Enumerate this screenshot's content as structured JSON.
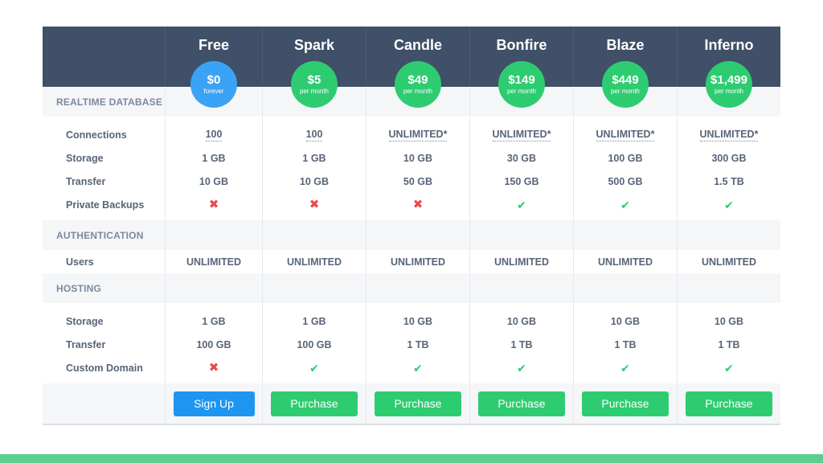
{
  "plans": [
    {
      "name": "Free",
      "price": "$0",
      "period": "forever",
      "accent": "#3aa3f5",
      "button": "Sign Up"
    },
    {
      "name": "Spark",
      "price": "$5",
      "period": "per month",
      "accent": "#2ecc71",
      "button": "Purchase"
    },
    {
      "name": "Candle",
      "price": "$49",
      "period": "per month",
      "accent": "#2ecc71",
      "button": "Purchase"
    },
    {
      "name": "Bonfire",
      "price": "$149",
      "period": "per month",
      "accent": "#2ecc71",
      "button": "Purchase"
    },
    {
      "name": "Blaze",
      "price": "$449",
      "period": "per month",
      "accent": "#2ecc71",
      "button": "Purchase"
    },
    {
      "name": "Inferno",
      "price": "$1,499",
      "period": "per month",
      "accent": "#2ecc71",
      "button": "Purchase"
    }
  ],
  "sections": [
    {
      "title": "REALTIME DATABASE",
      "rows": [
        {
          "label": "Connections",
          "values": [
            "100",
            "100",
            "UNLIMITED*",
            "UNLIMITED*",
            "UNLIMITED*",
            "UNLIMITED*"
          ]
        },
        {
          "label": "Storage",
          "values": [
            "1 GB",
            "1 GB",
            "10 GB",
            "30 GB",
            "100 GB",
            "300 GB"
          ]
        },
        {
          "label": "Transfer",
          "values": [
            "10 GB",
            "10 GB",
            "50 GB",
            "150 GB",
            "500 GB",
            "1.5 TB"
          ]
        },
        {
          "label": "Private Backups",
          "values": [
            "x",
            "x",
            "x",
            "check",
            "check",
            "check"
          ]
        }
      ]
    },
    {
      "title": "AUTHENTICATION",
      "rows": [
        {
          "label": "Users",
          "values": [
            "UNLIMITED",
            "UNLIMITED",
            "UNLIMITED",
            "UNLIMITED",
            "UNLIMITED",
            "UNLIMITED"
          ]
        }
      ]
    },
    {
      "title": "HOSTING",
      "rows": [
        {
          "label": "Storage",
          "values": [
            "1 GB",
            "1 GB",
            "10 GB",
            "10 GB",
            "10 GB",
            "10 GB"
          ]
        },
        {
          "label": "Transfer",
          "values": [
            "100 GB",
            "100 GB",
            "1 TB",
            "1 TB",
            "1 TB",
            "1 TB"
          ]
        },
        {
          "label": "Custom Domain",
          "values": [
            "x",
            "check",
            "check",
            "check",
            "check",
            "check"
          ]
        }
      ]
    }
  ],
  "colors": {
    "header": "#3f5068",
    "green": "#2ecc71",
    "blue": "#1e96f0",
    "red": "#e84a4a",
    "section_bg": "#f5f6f8",
    "footer_bar": "#5ccf8e"
  },
  "icons": {
    "unavailable": "x-icon",
    "available": "check-icon"
  }
}
